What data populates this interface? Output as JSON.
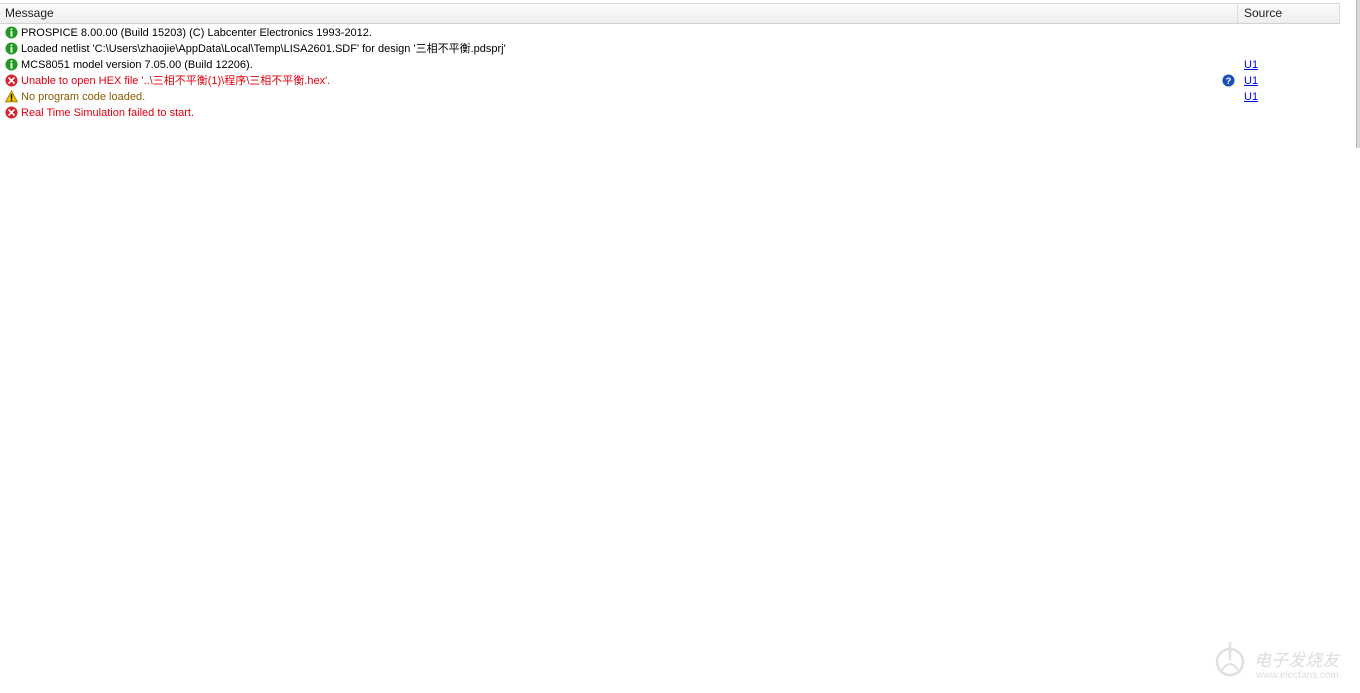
{
  "header": {
    "message_label": "Message",
    "source_label": "Source"
  },
  "rows": [
    {
      "type": "info",
      "icon": "info-icon",
      "text": "PROSPICE 8.00.00 (Build 15203) (C) Labcenter Electronics 1993-2012.",
      "source": ""
    },
    {
      "type": "info",
      "icon": "info-icon",
      "text": "Loaded netlist 'C:\\Users\\zhaojie\\AppData\\Local\\Temp\\LISA2601.SDF' for design '三相不平衡.pdsprj'",
      "source": ""
    },
    {
      "type": "info",
      "icon": "info-icon",
      "text": "MCS8051 model version 7.05.00 (Build 12206).",
      "source": "U1"
    },
    {
      "type": "error",
      "icon": "error-icon",
      "text": "Unable to open HEX file '..\\三相不平衡(1)\\程序\\三相不平衡.hex'.",
      "source": "U1",
      "help": true
    },
    {
      "type": "warning",
      "icon": "warning-icon",
      "text": "No program code loaded.",
      "source": "U1"
    },
    {
      "type": "error",
      "icon": "error-icon",
      "text": "Real Time Simulation failed to start.",
      "source": ""
    }
  ],
  "colors": {
    "info": "#1f9a1f",
    "error": "#d9232f",
    "warning": "#f2c200",
    "help": "#1b4fb8",
    "link": "#0000ee"
  },
  "watermark": {
    "text": "电子发烧友",
    "url": "www.elecfans.com"
  }
}
